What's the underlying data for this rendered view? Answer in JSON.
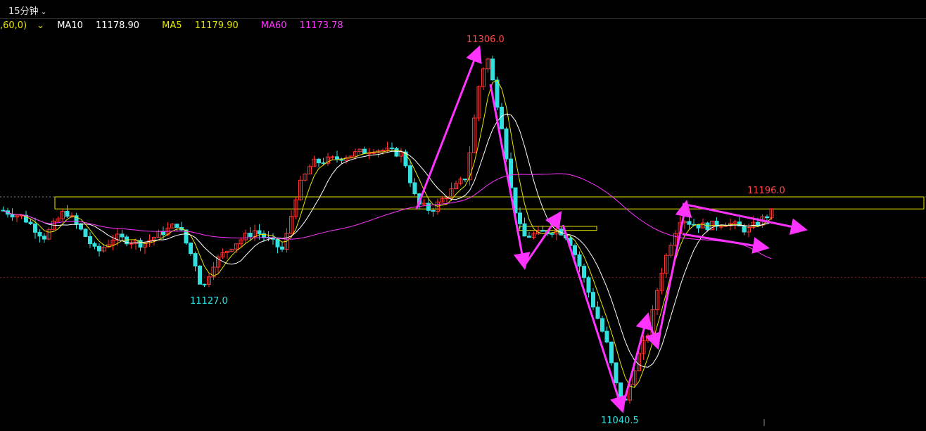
{
  "toolbar": {
    "period_label": "15分钟"
  },
  "legend": {
    "params_label": ",60,0)",
    "items": [
      {
        "name": "MA10",
        "value": "11178.90",
        "color": "#ffffff"
      },
      {
        "name": "MA5",
        "value": "11179.90",
        "color": "#e6e600"
      },
      {
        "name": "MA60",
        "value": "11173.78",
        "color": "#ff33ff"
      }
    ]
  },
  "colors": {
    "up": "#ff3333",
    "down": "#33e0e0",
    "ma5": "#e6e600",
    "ma10": "#ffffff",
    "ma60": "#ff33ff",
    "arrow": "#ff33ff",
    "box": "#e6e600",
    "dotted_line": "#ffffff",
    "red_dotted": "#aa2222"
  },
  "chart_data": {
    "type": "candlestick",
    "interval": "15分钟",
    "ylim": [
      11035,
      11315
    ],
    "annotations": [
      {
        "text": "11306.0",
        "value": 11306.0,
        "kind": "high",
        "color": "#ff4444"
      },
      {
        "text": "11127.0",
        "value": 11127.0,
        "kind": "low",
        "color": "#33e0e0"
      },
      {
        "text": "11040.5",
        "value": 11040.5,
        "kind": "low",
        "color": "#33e0e0"
      },
      {
        "text": "11196.0",
        "value": 11196.0,
        "kind": "recent-high",
        "color": "#ff4444"
      }
    ],
    "reference_levels": [
      11200,
      11140
    ],
    "zones": [
      {
        "from": 11191,
        "to": 11200
      },
      {
        "from": 11175,
        "to": 11178
      }
    ]
  }
}
